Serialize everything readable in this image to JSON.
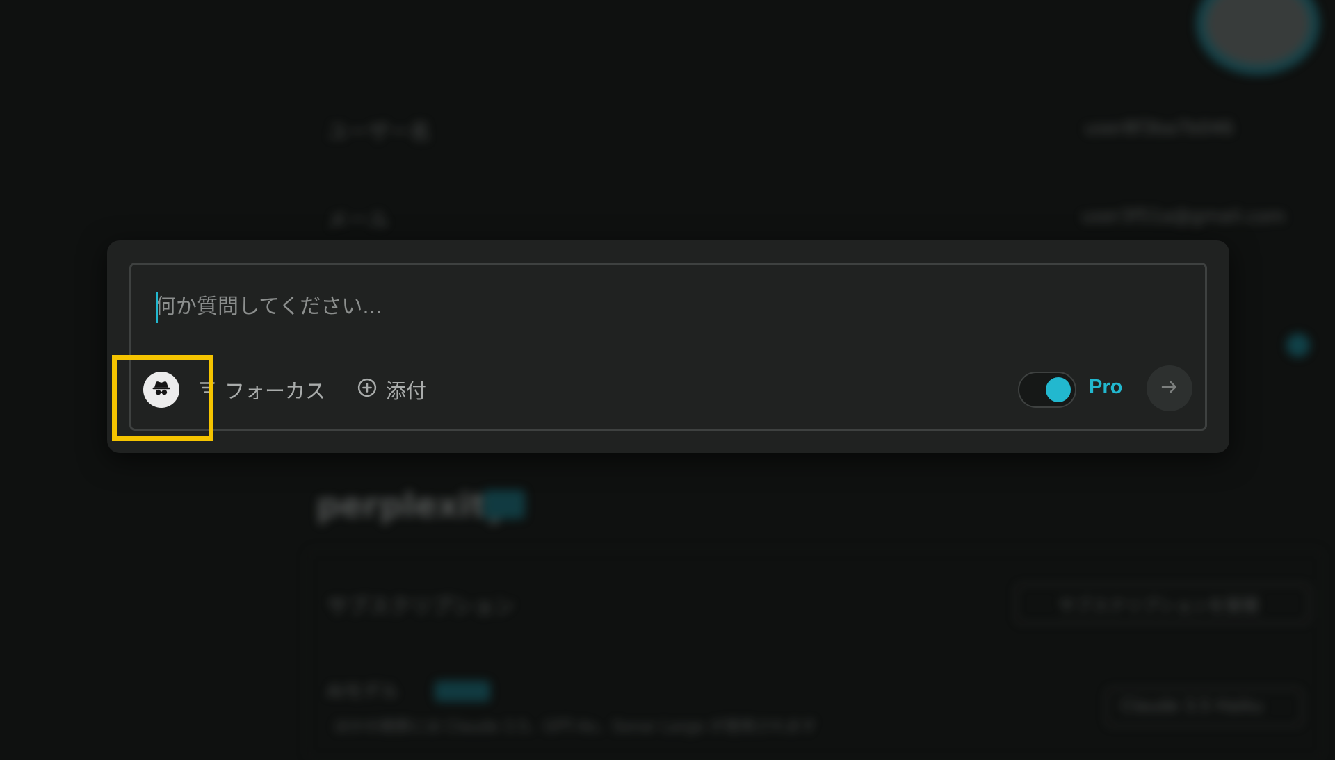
{
  "background": {
    "rows": [
      {
        "label": "ユーザー名",
        "value": "user8f3ba7b046"
      },
      {
        "label": "メール",
        "value": "user3f51a@gmail.com"
      }
    ],
    "brand": "perplexity",
    "settings_row_label": "サブスクリプション",
    "settings_row_button": "サブスクリプションを管理",
    "model_row_label": "AIモデル",
    "model_row_select": "Claude 3.5 Haiku",
    "model_row_subtext": "ほかの検索には Claude 3.5、GPT-4o、Sonar Large が使用されます"
  },
  "composer": {
    "placeholder": "何か質問してください...",
    "value": "",
    "focus_label": "フォーカス",
    "attach_label": "添付",
    "pro_label": "Pro",
    "pro_enabled": true
  },
  "icons": {
    "incognito": "incognito-icon",
    "focus": "filter-lines-icon",
    "attach": "plus-circle-icon",
    "send": "arrow-right-icon"
  },
  "colors": {
    "accent": "#22b8cf",
    "highlight": "#f5c400",
    "modal_bg": "#202221",
    "page_bg": "#0f1110"
  }
}
